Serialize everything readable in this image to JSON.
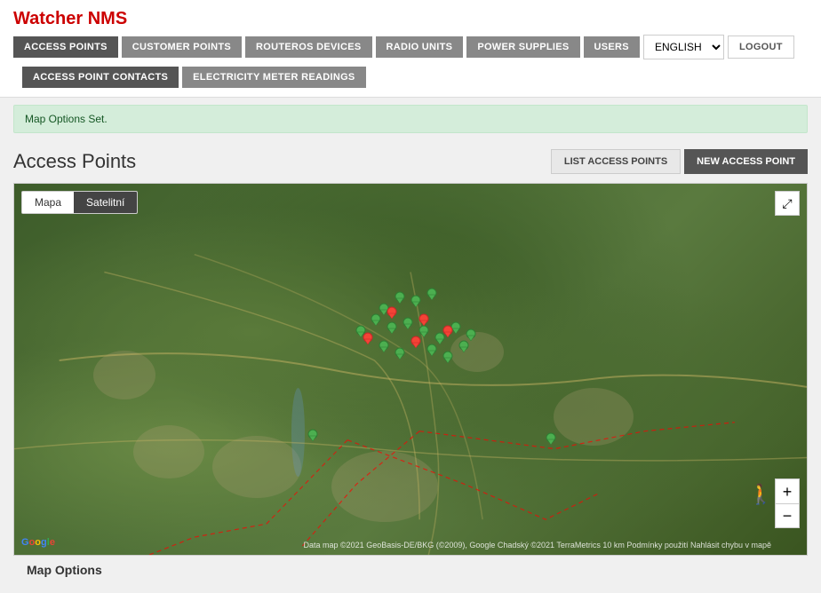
{
  "app": {
    "title": "Watcher",
    "title_accent": "NMS"
  },
  "nav": {
    "items": [
      {
        "label": "ACCESS POINTS",
        "active": true
      },
      {
        "label": "CUSTOMER POINTS",
        "active": false
      },
      {
        "label": "ROUTEROS DEVICES",
        "active": false
      },
      {
        "label": "RADIO UNITS",
        "active": false
      },
      {
        "label": "POWER SUPPLIES",
        "active": false
      },
      {
        "label": "USERS",
        "active": false
      }
    ],
    "language": "ENGLISH",
    "logout": "LOGOUT",
    "secondary": [
      {
        "label": "ACCESS POINT CONTACTS",
        "active": true
      },
      {
        "label": "ELECTRICITY METER READINGS",
        "active": false
      }
    ]
  },
  "alert": {
    "message": "Map Options Set."
  },
  "section": {
    "title": "Access Points",
    "buttons": {
      "list": "LIST ACCESS POINTS",
      "new": "NEW ACCESS POINT"
    }
  },
  "map": {
    "tab_mapa": "Mapa",
    "tab_satelitni": "Satelitní",
    "active_tab": "Satelitní",
    "fullscreen_icon": "⤢",
    "zoom_in": "+",
    "zoom_out": "−",
    "google_label": "Google",
    "attribution": "Data map ©2021 GeoBasis-DE/BKG (©2009), Google Chadský ©2021 TerraMetrics  10 km  Podmínky použití  Nahlásit chybu v mapě",
    "scale_label": "10 km"
  },
  "map_options": {
    "label": "Map Options"
  }
}
